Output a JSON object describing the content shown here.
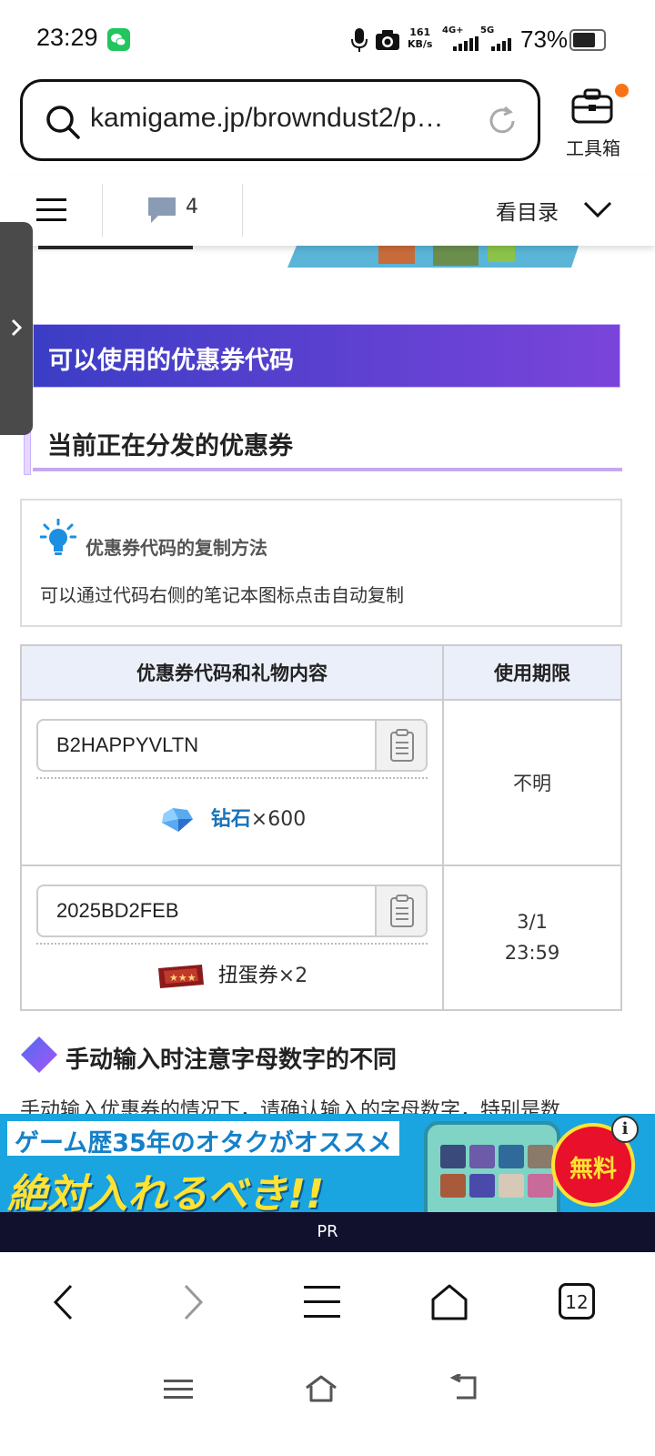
{
  "status_bar": {
    "time": "23:29",
    "net_speed_value": "161",
    "net_speed_unit": "KB/s",
    "network_1": "4G+",
    "network_2": "5G",
    "battery_percent": "73%"
  },
  "browser": {
    "url": "kamigame.jp/browndust2/p…",
    "toolbox_label": "工具箱",
    "tab_count": "12"
  },
  "page_nav": {
    "comment_count": "4",
    "toc_label": "看目录"
  },
  "article": {
    "section_title": "可以使用的优惠券代码",
    "subsection_title": "当前正在分发的优惠券",
    "tip": {
      "title": "优惠券代码的复制方法",
      "body": "可以通过代码右侧的笔记本图标点击自动复制"
    },
    "table": {
      "headers": [
        "优惠券代码和礼物内容",
        "使用期限"
      ],
      "rows": [
        {
          "code": "B2HAPPYVLTN",
          "reward_name": "钻石",
          "reward_qty": "×600",
          "expiry_line1": "不明",
          "expiry_line2": ""
        },
        {
          "code": "2025BD2FEB",
          "reward_name": "扭蛋券",
          "reward_qty": "×2",
          "expiry_line1": "3/1",
          "expiry_line2": "23:59"
        }
      ]
    },
    "note_heading": "手动输入时注意字母数字的不同",
    "note_text_partial": "手动输入优惠券的情况下，请确认输入的字母数字，特别是数"
  },
  "ad": {
    "line1": "ゲーム歴35年のオタクがオススメ",
    "line2": "絶対入れるべき!!",
    "badge": "無料",
    "info": "i",
    "pr_label": "PR"
  },
  "colors": {
    "heading_gradient_start": "#3b3dc5",
    "heading_gradient_end": "#7a44da",
    "reward_link": "#1a73b8",
    "table_header_bg": "#eaeffa"
  },
  "icons": [
    "wechat-icon",
    "mic-icon",
    "camera-icon",
    "search-icon",
    "reload-icon",
    "toolbox-icon",
    "menu-icon",
    "comment-icon",
    "chevron-down-icon",
    "lightbulb-icon",
    "clipboard-icon",
    "diamond-icon",
    "gacha-ticket-icon",
    "back-icon",
    "forward-icon",
    "menu-icon",
    "home-icon",
    "tabs-icon"
  ]
}
